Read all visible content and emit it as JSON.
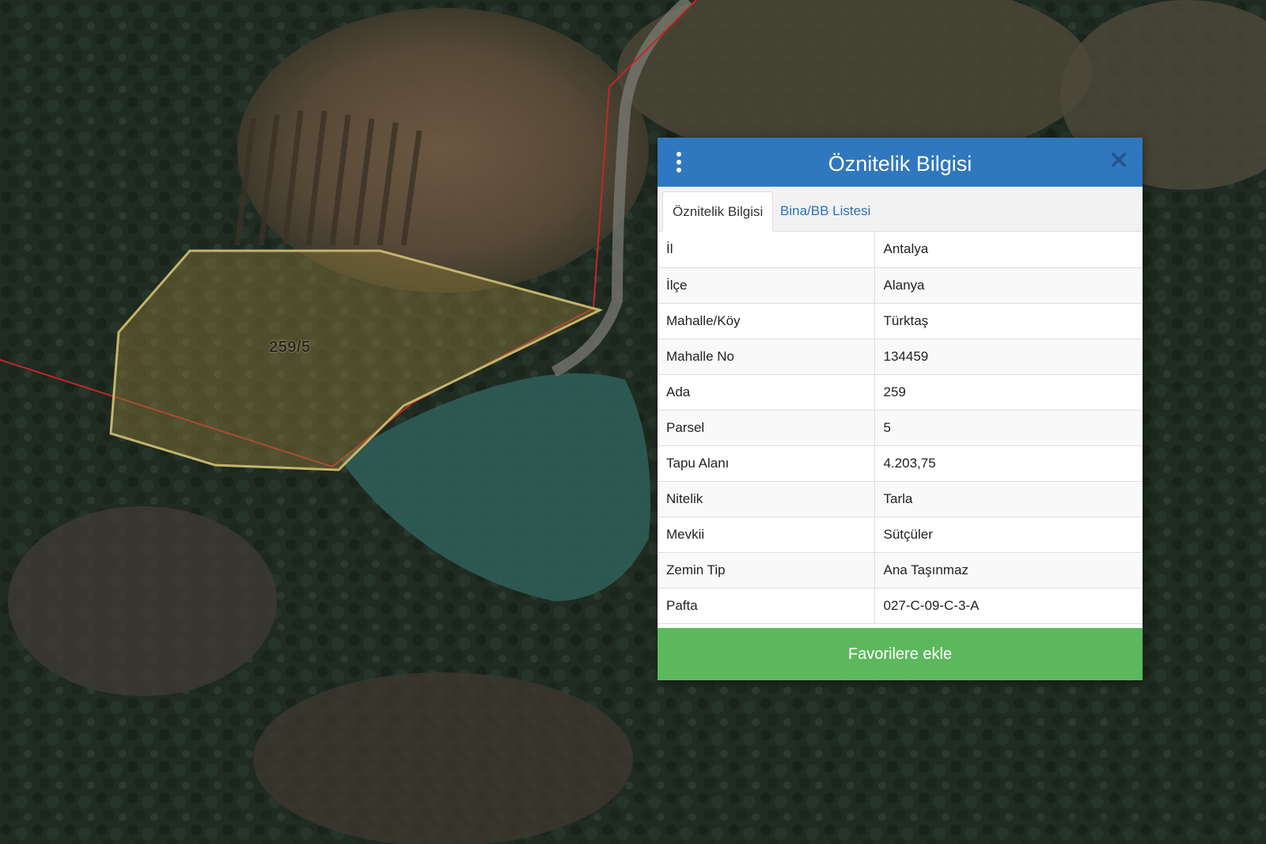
{
  "map": {
    "parcel_label": "259/5"
  },
  "panel": {
    "title": "Öznitelik Bilgisi",
    "header_color": "#2f78bf",
    "tabs": [
      {
        "label": "Öznitelik Bilgisi",
        "active": true
      },
      {
        "label": "Bina/BB Listesi",
        "active": false
      }
    ],
    "rows": [
      {
        "key": "İl",
        "value": "Antalya"
      },
      {
        "key": "İlçe",
        "value": "Alanya"
      },
      {
        "key": "Mahalle/Köy",
        "value": "Türktaş"
      },
      {
        "key": "Mahalle No",
        "value": "134459"
      },
      {
        "key": "Ada",
        "value": "259"
      },
      {
        "key": "Parsel",
        "value": "5"
      },
      {
        "key": "Tapu Alanı",
        "value": "4.203,75"
      },
      {
        "key": "Nitelik",
        "value": "Tarla"
      },
      {
        "key": "Mevkii",
        "value": "Sütçüler"
      },
      {
        "key": "Zemin Tip",
        "value": "Ana Taşınmaz"
      },
      {
        "key": "Pafta",
        "value": "027-C-09-C-3-A"
      }
    ],
    "favorite_button_label": "Favorilere ekle",
    "favorite_button_color": "#5cb85c",
    "icons": {
      "menu": "vertical-dots-icon",
      "close": "close-icon"
    }
  }
}
